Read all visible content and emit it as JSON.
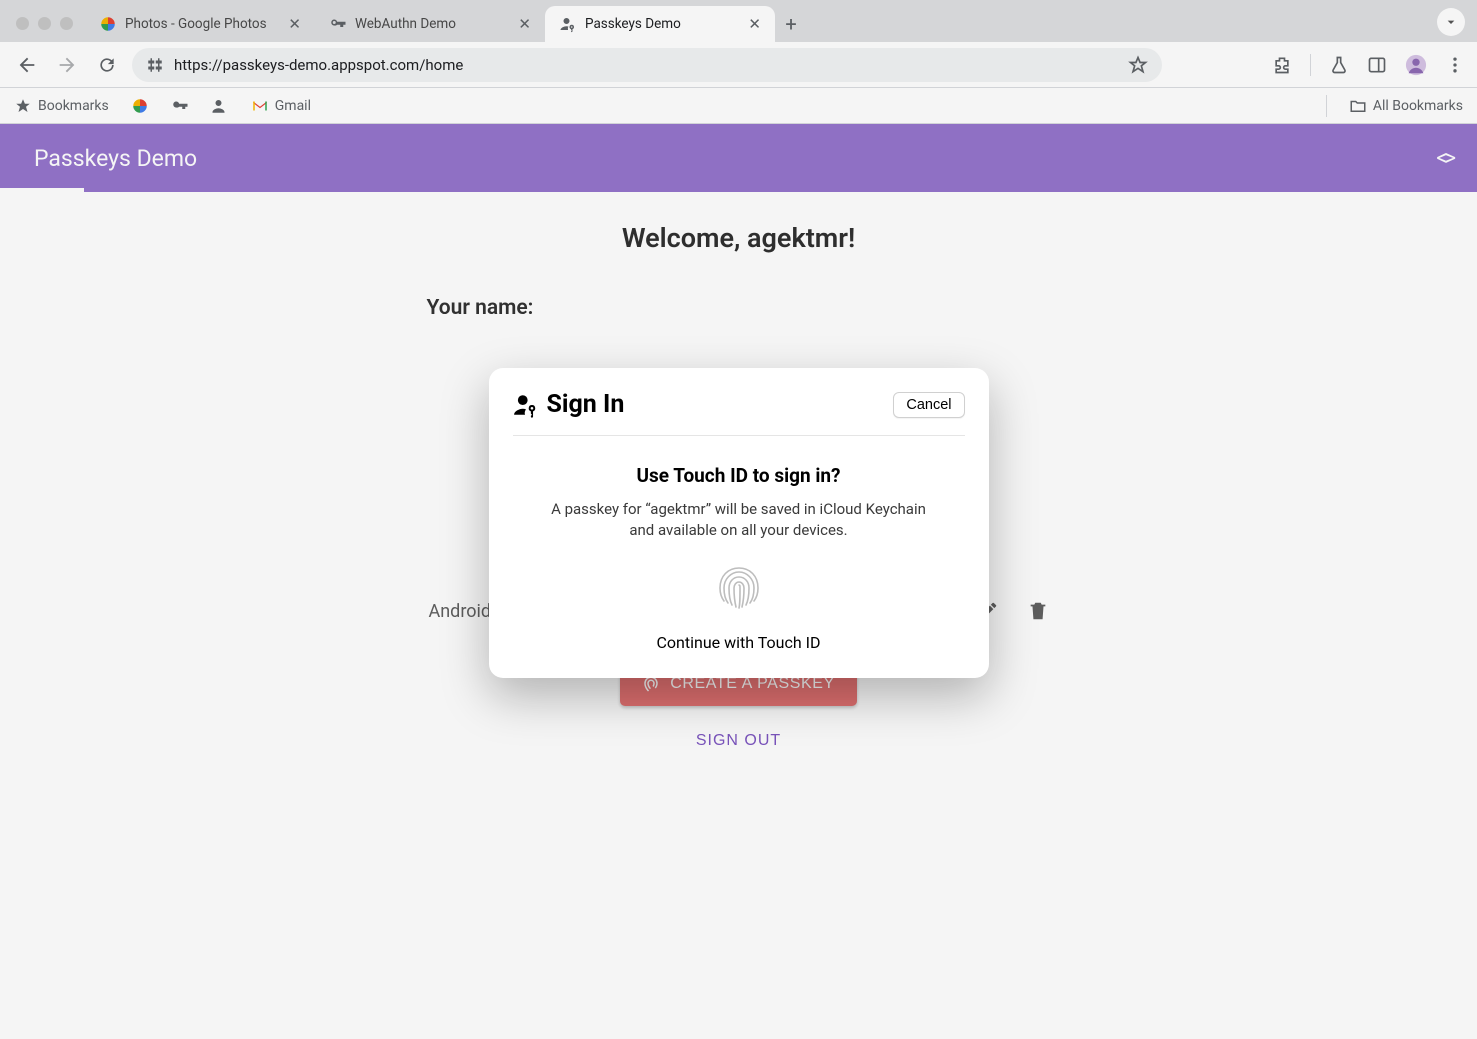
{
  "browser": {
    "tabs": [
      {
        "title": "Photos - Google Photos"
      },
      {
        "title": "WebAuthn Demo"
      },
      {
        "title": "Passkeys Demo"
      }
    ],
    "url": "https://passkeys-demo.appspot.com/home",
    "bookmarks": {
      "label": "Bookmarks",
      "gmail": "Gmail",
      "all": "All Bookmarks"
    }
  },
  "app": {
    "header_title": "Passkeys Demo",
    "welcome": "Welcome, agektmr!",
    "your_name_label": "Your name:",
    "list_item_label": "Android",
    "create_passkey_label": "CREATE A PASSKEY",
    "sign_out_label": "SIGN OUT"
  },
  "modal": {
    "title": "Sign In",
    "cancel": "Cancel",
    "question": "Use Touch ID to sign in?",
    "description": "A passkey for “agektmr” will be saved in iCloud Keychain and available on all your devices.",
    "continue": "Continue with Touch ID"
  }
}
